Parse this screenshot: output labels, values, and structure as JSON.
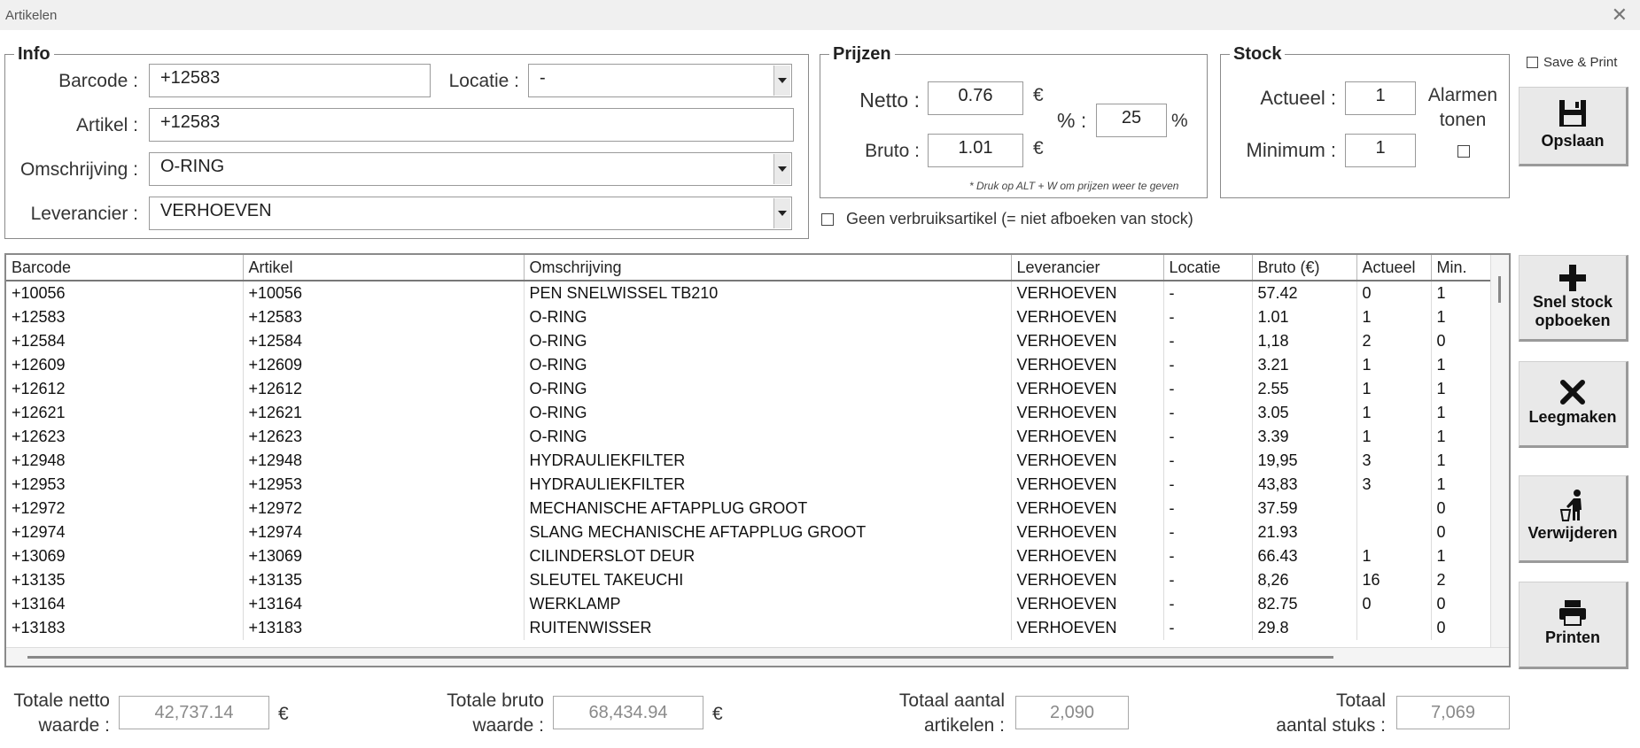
{
  "window": {
    "title": "Artikelen"
  },
  "info": {
    "legend": "Info",
    "barcode_label": "Barcode :",
    "barcode_value": "+12583",
    "locatie_label": "Locatie :",
    "locatie_value": "-",
    "artikel_label": "Artikel :",
    "artikel_value": "+12583",
    "omschrijving_label": "Omschrijving :",
    "omschrijving_value": "O-RING",
    "leverancier_label": "Leverancier :",
    "leverancier_value": "VERHOEVEN"
  },
  "prijzen": {
    "legend": "Prijzen",
    "netto_label": "Netto :",
    "netto_value": "0.76",
    "bruto_label": "Bruto :",
    "bruto_value": "1.01",
    "currency": "€",
    "pct_label": "% :",
    "pct_value": "25",
    "pct_symbol": "%",
    "hint": "* Druk op ALT + W om prijzen weer te geven"
  },
  "stock": {
    "legend": "Stock",
    "actueel_label": "Actueel :",
    "actueel_value": "1",
    "minimum_label": "Minimum :",
    "minimum_value": "1",
    "alarmen_label_1": "Alarmen",
    "alarmen_label_2": "tonen"
  },
  "geen_verbruik_label": "Geen verbruiksartikel (= niet afboeken van stock)",
  "save_print_label": "Save & Print",
  "buttons": {
    "opslaan": "Opslaan",
    "snel_stock_1": "Snel stock",
    "snel_stock_2": "opboeken",
    "leegmaken": "Leegmaken",
    "verwijderen": "Verwijderen",
    "printen": "Printen"
  },
  "table": {
    "columns": [
      "Barcode",
      "Artikel",
      "Omschrijving",
      "Leverancier",
      "Locatie",
      "Bruto (€)",
      "Actueel",
      "Min."
    ],
    "rows": [
      [
        "+10056",
        "+10056",
        "PEN SNELWISSEL TB210",
        "VERHOEVEN",
        "-",
        "57.42",
        "0",
        "1"
      ],
      [
        "+12583",
        "+12583",
        "O-RING",
        "VERHOEVEN",
        "-",
        "1.01",
        "1",
        "1"
      ],
      [
        "+12584",
        "+12584",
        "O-RING",
        "VERHOEVEN",
        "-",
        "1,18",
        "2",
        "0"
      ],
      [
        "+12609",
        "+12609",
        "O-RING",
        "VERHOEVEN",
        "-",
        "3.21",
        "1",
        "1"
      ],
      [
        "+12612",
        "+12612",
        "O-RING",
        "VERHOEVEN",
        "-",
        "2.55",
        "1",
        "1"
      ],
      [
        "+12621",
        "+12621",
        "O-RING",
        "VERHOEVEN",
        "-",
        "3.05",
        "1",
        "1"
      ],
      [
        "+12623",
        "+12623",
        "O-RING",
        "VERHOEVEN",
        "-",
        "3.39",
        "1",
        "1"
      ],
      [
        "+12948",
        "+12948",
        "HYDRAULIEKFILTER",
        "VERHOEVEN",
        "-",
        "19,95",
        "3",
        "1"
      ],
      [
        "+12953",
        "+12953",
        "HYDRAULIEKFILTER",
        "VERHOEVEN",
        "-",
        "43,83",
        "3",
        "1"
      ],
      [
        "+12972",
        "+12972",
        "MECHANISCHE AFTAPPLUG GROOT",
        "VERHOEVEN",
        "-",
        "37.59",
        "",
        "0"
      ],
      [
        "+12974",
        "+12974",
        "SLANG MECHANISCHE AFTAPPLUG GROOT",
        "VERHOEVEN",
        "-",
        "21.93",
        "",
        "0"
      ],
      [
        "+13069",
        "+13069",
        "CILINDERSLOT DEUR",
        "VERHOEVEN",
        "-",
        "66.43",
        "1",
        "1"
      ],
      [
        "+13135",
        "+13135",
        "SLEUTEL TAKEUCHI",
        "VERHOEVEN",
        "-",
        "8,26",
        "16",
        "2"
      ],
      [
        "+13164",
        "+13164",
        "WERKLAMP",
        "VERHOEVEN",
        "-",
        "82.75",
        "0",
        "0"
      ],
      [
        "+13183",
        "+13183",
        "RUITENWISSER",
        "VERHOEVEN",
        "-",
        "29.8",
        "",
        "0"
      ]
    ]
  },
  "totals": {
    "netto_label_1": "Totale netto",
    "netto_label_2": "waarde :",
    "netto_value": "42,737.14",
    "bruto_label_1": "Totale bruto",
    "bruto_label_2": "waarde :",
    "bruto_value": "68,434.94",
    "artikelen_label_1": "Totaal aantal",
    "artikelen_label_2": "artikelen :",
    "artikelen_value": "2,090",
    "stuks_label_1": "Totaal",
    "stuks_label_2": "aantal stuks :",
    "stuks_value": "7,069",
    "currency": "€"
  }
}
